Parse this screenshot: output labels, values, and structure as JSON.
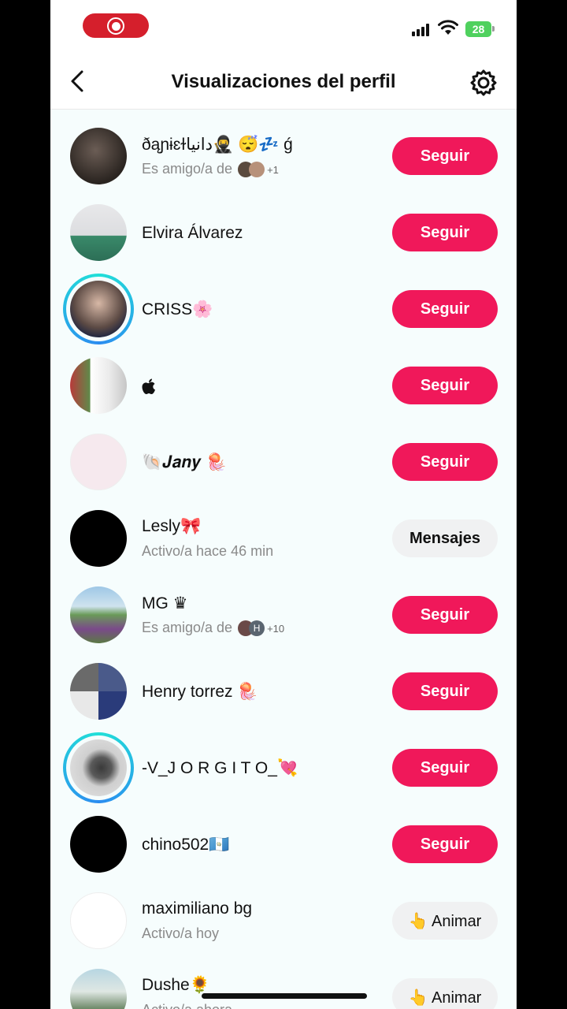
{
  "status": {
    "battery": "28"
  },
  "header": {
    "title": "Visualizaciones del perfil"
  },
  "viewers": [
    {
      "name": "ðąɲɨɛɫدانيا🥷 😴💤 ǵ",
      "sub_prefix": "Es amigo/a de",
      "sub_more": "+1",
      "action": "Seguir"
    },
    {
      "name": "Elvira Álvarez",
      "action": "Seguir"
    },
    {
      "name": "CRISS🌸",
      "action": "Seguir"
    },
    {
      "name": "",
      "action": "Seguir"
    },
    {
      "name": "🐚𝑱𝒂𝒏𝒚 🪼",
      "action": "Seguir"
    },
    {
      "name": "Lesly🎀",
      "sub": "Activo/a hace 46 min",
      "action": "Mensajes"
    },
    {
      "name": "MG ♛",
      "sub_prefix": "Es amigo/a de",
      "sub_more": "+10",
      "mini_letter": "H",
      "action": "Seguir"
    },
    {
      "name": "Henry torrez 🪼",
      "action": "Seguir"
    },
    {
      "name": "-V_J O R G I T O_💘",
      "action": "Seguir"
    },
    {
      "name": "chino502🇬🇹",
      "action": "Seguir"
    },
    {
      "name": "maximiliano bg",
      "sub": "Activo/a hoy",
      "action": "👆 Animar"
    },
    {
      "name": "Dushe🌻",
      "sub": "Activo/a ahora",
      "action": "👆 Animar"
    }
  ],
  "colors": {
    "follow": "#f0185a",
    "grey_button": "#f0f1f2",
    "story_ring": "#21e0d8"
  },
  "icons": {
    "back": "chevron-left-icon",
    "settings": "gear-icon",
    "apple": "apple-icon"
  }
}
